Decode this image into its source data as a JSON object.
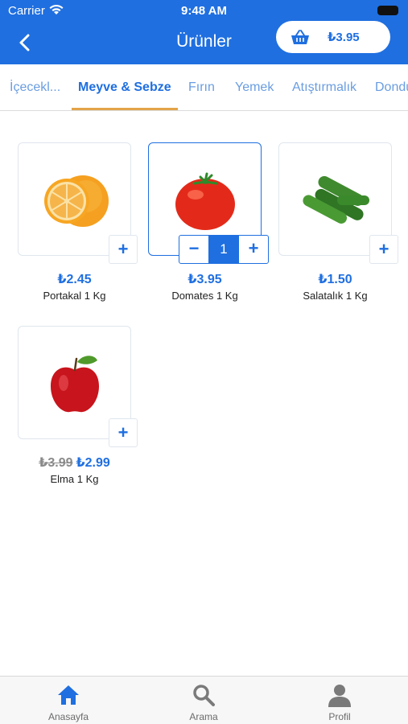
{
  "status_bar": {
    "carrier": "Carrier",
    "time": "9:48 AM"
  },
  "header": {
    "title": "Ürünler",
    "cart_total": "₺3.95"
  },
  "tabs": [
    {
      "label": "İçecekl..."
    },
    {
      "label": "Meyve & Sebze",
      "active": true
    },
    {
      "label": "Fırın"
    },
    {
      "label": "Yemek"
    },
    {
      "label": "Atıştırmalık"
    },
    {
      "label": "Dondu"
    }
  ],
  "products": [
    {
      "name": "Portakal 1 Kg",
      "price": "₺2.45",
      "image": "orange",
      "add_label": "+"
    },
    {
      "name": "Domates 1 Kg",
      "price": "₺3.95",
      "image": "tomato",
      "in_cart": true,
      "quantity": "1",
      "minus_label": "−",
      "plus_label": "+"
    },
    {
      "name": "Salatalık 1 Kg",
      "price": "₺1.50",
      "image": "cucumber",
      "add_label": "+"
    },
    {
      "name": "Elma 1 Kg",
      "old_price": "₺3.99",
      "price": "₺2.99",
      "image": "apple",
      "add_label": "+"
    }
  ],
  "bottom_nav": [
    {
      "label": "Anasayfa",
      "icon": "home-icon",
      "active": true
    },
    {
      "label": "Arama",
      "icon": "search-icon"
    },
    {
      "label": "Profil",
      "icon": "profile-icon"
    }
  ],
  "colors": {
    "primary": "#1f6fe0",
    "tab_indicator": "#e3a34a",
    "muted": "#8a8a8a"
  }
}
